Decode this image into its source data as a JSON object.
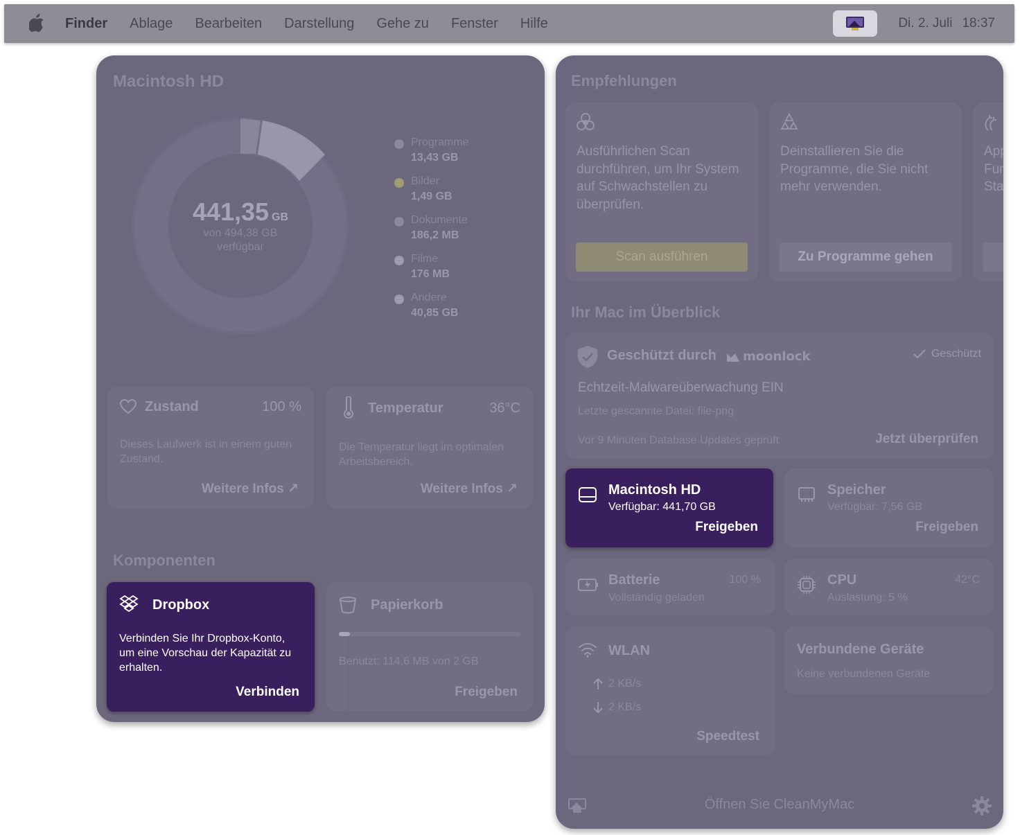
{
  "menubar": {
    "apple_icon": "apple-logo-icon",
    "items": [
      "Finder",
      "Ablage",
      "Bearbeiten",
      "Darstellung",
      "Gehe zu",
      "Fenster",
      "Hilfe"
    ],
    "status_icon": "cleanmymac-menu-icon",
    "date": "Di. 2. Juli",
    "time": "18:37"
  },
  "storage": {
    "title": "Macintosh HD",
    "available": "441,35",
    "unit": "GB",
    "of_total": "von 494,38 GB",
    "available_label": "verfügbar",
    "legend": [
      {
        "label": "Programme",
        "value": "13,43 GB",
        "color": "#8d889b"
      },
      {
        "label": "Bilder",
        "value": "1,49 GB",
        "color": "#a09c6e"
      },
      {
        "label": "Dokumente",
        "value": "186,2 MB",
        "color": "#8d889b"
      },
      {
        "label": "Filme",
        "value": "176 MB",
        "color": "#9e9aad"
      },
      {
        "label": "Andere",
        "value": "40,85 GB",
        "color": "#9e9aad"
      }
    ]
  },
  "health": {
    "title": "Zustand",
    "value": "100 %",
    "text": "Dieses Laufwerk ist in einem guten Zustand.",
    "link": "Weitere Infos ↗"
  },
  "temperature": {
    "title": "Temperatur",
    "value": "36°C",
    "text": "Die Temperatur liegt im optimalen Arbeitsbereich.",
    "link": "Weitere Infos ↗"
  },
  "components": {
    "title": "Komponenten",
    "dropbox": {
      "title": "Dropbox",
      "text": "Verbinden Sie Ihr Dropbox-Konto, um eine Vorschau der Kapazität zu erhalten.",
      "link": "Verbinden"
    },
    "trash": {
      "title": "Papierkorb",
      "used": "Benutzt: 114,6 MB von 2 GB",
      "used_fraction": 0.057,
      "link": "Freigeben"
    }
  },
  "recommendations": {
    "title": "Empfehlungen",
    "items": [
      {
        "icon": "biohazard-icon",
        "text": "Ausführlichen Scan durchführen, um Ihr System auf Schwachstellen zu überprüfen.",
        "button": "Scan ausführen"
      },
      {
        "icon": "apps-icon",
        "text": "Deinstallieren Sie die Programme, die Sie nicht mehr verwenden.",
        "button": "Zu Programme gehen"
      },
      {
        "icon": "update-icon",
        "text": "App\nFun\nSta",
        "button": ""
      }
    ]
  },
  "overview": {
    "title": "Ihr Mac im Überblick",
    "protection": {
      "title": "Geschützt durch",
      "brand": "moonlock",
      "status": "Geschützt",
      "realtime": "Echtzeit-Malwareüberwachung EIN",
      "last_file": "Letzte gescannte Datei: file-png",
      "updates": "Vor 9 Minuten Database Updates geprüft",
      "check_link": "Jetzt überprüfen"
    },
    "disk": {
      "title": "Macintosh HD",
      "sub": "Verfügbar: 441,70 GB",
      "link": "Freigeben"
    },
    "memory": {
      "title": "Speicher",
      "sub": "Verfügbar: 7,56 GB",
      "link": "Freigeben"
    },
    "battery": {
      "title": "Batterie",
      "value": "100 %",
      "sub": "Vollständig geladen"
    },
    "cpu": {
      "title": "CPU",
      "value": "42°C",
      "sub": "Auslastung: 5 %"
    },
    "wlan": {
      "title": "WLAN",
      "up": "2 KB/s",
      "down": "2 KB/s",
      "link": "Speedtest"
    },
    "devices": {
      "title": "Verbundene Geräte",
      "sub": "Keine verbundenen Geräte"
    }
  },
  "footer": {
    "open": "Öffnen Sie CleanMyMac",
    "app_icon": "cleanmymac-icon",
    "settings_icon": "gear-icon"
  },
  "colors": {
    "panel": "#6c677c",
    "card": "#726d82",
    "accent_purple": "#3a1f5f",
    "scan_button": "#8f8a74"
  }
}
